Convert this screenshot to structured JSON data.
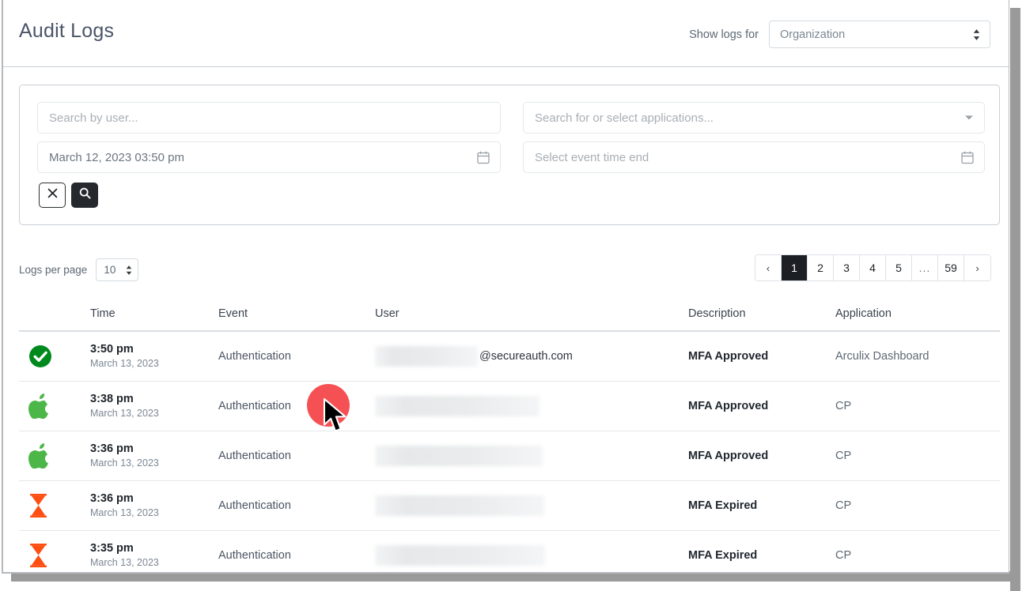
{
  "header": {
    "title": "Audit Logs",
    "show_logs_label": "Show logs for",
    "org_select_value": "Organization",
    "org_select_icon": "stepper-updown-icon"
  },
  "filters": {
    "user_search_placeholder": "Search by user...",
    "app_search_placeholder": "Search for or select applications...",
    "app_dropdown_icon": "chevron-down-icon",
    "time_start_value": "March 12, 2023 03:50 pm",
    "time_start_icon": "calendar-icon",
    "time_end_placeholder": "Select event time end",
    "time_end_icon": "calendar-icon",
    "clear_button_icon": "close-x-icon",
    "search_button_icon": "search-icon"
  },
  "toolbar": {
    "logs_per_page_label": "Logs per page",
    "logs_per_page_value": "10",
    "logs_per_page_icon": "stepper-updown-icon"
  },
  "pagination": {
    "prev_label": "‹",
    "next_label": "›",
    "pages": [
      "1",
      "2",
      "3",
      "4",
      "5",
      "...",
      "59"
    ],
    "active_page": "1",
    "ellipsis_index": 5
  },
  "table": {
    "columns": [
      "",
      "Time",
      "Event",
      "User",
      "Description",
      "Application"
    ],
    "rows": [
      {
        "status_icon": "green-check-circle-icon",
        "status_color": "#008a1e",
        "time": "3:50 pm",
        "date": "March 13, 2023",
        "event": "Authentication",
        "user_redacted": true,
        "user_redacted_width": 130,
        "user_domain": "@secureauth.com",
        "description": "MFA Approved",
        "application": "Arculix Dashboard"
      },
      {
        "status_icon": "apple-logo-icon",
        "status_color": "#4cb748",
        "time": "3:38 pm",
        "date": "March 13, 2023",
        "event": "Authentication",
        "user_redacted": true,
        "user_redacted_width": 208,
        "user_domain": "",
        "description": "MFA Approved",
        "application": "CP"
      },
      {
        "status_icon": "apple-logo-icon",
        "status_color": "#4cb748",
        "time": "3:36 pm",
        "date": "March 13, 2023",
        "event": "Authentication",
        "user_redacted": true,
        "user_redacted_width": 212,
        "user_domain": "",
        "description": "MFA Approved",
        "application": "CP"
      },
      {
        "status_icon": "hourglass-icon",
        "status_color": "#fd4f13",
        "time": "3:36 pm",
        "date": "March 13, 2023",
        "event": "Authentication",
        "user_redacted": true,
        "user_redacted_width": 214,
        "user_domain": "",
        "description": "MFA Expired",
        "application": "CP"
      },
      {
        "status_icon": "hourglass-icon",
        "status_color": "#fd4f13",
        "time": "3:35 pm",
        "date": "March 13, 2023",
        "event": "Authentication",
        "user_redacted": true,
        "user_redacted_width": 215,
        "user_domain": "",
        "description": "MFA Expired",
        "application": "CP"
      }
    ]
  },
  "overlay": {
    "click_marker_color": "#f4393c",
    "cursor_icon": "mouse-arrow-cursor"
  },
  "colors": {
    "title": "#4a5568",
    "dark_button": "#25292d",
    "active_page": "#1c1f23",
    "border": "#c9ced4"
  }
}
